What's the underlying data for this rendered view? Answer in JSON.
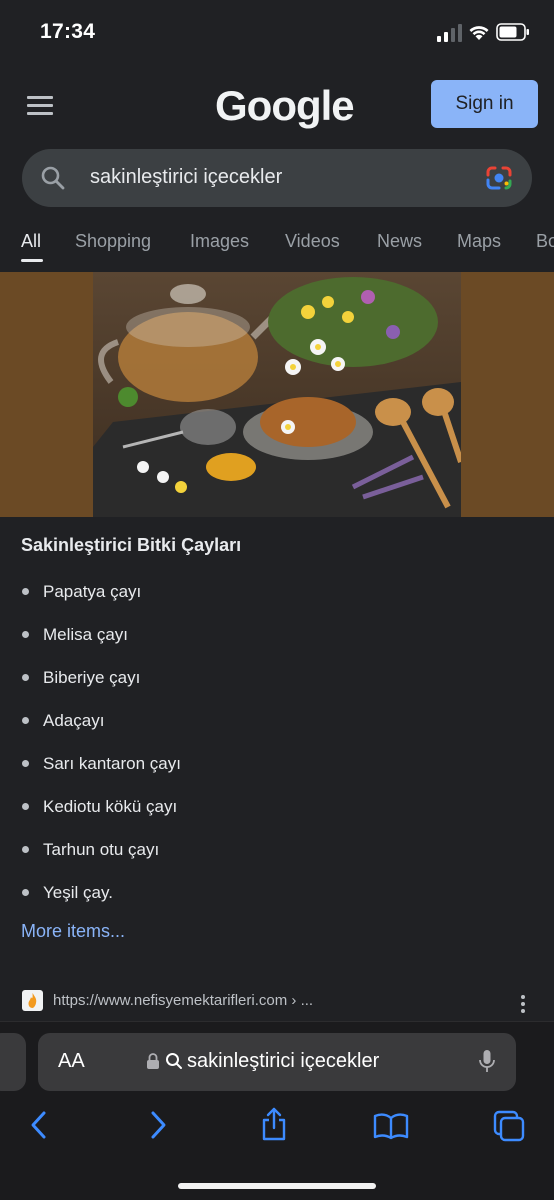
{
  "status_bar": {
    "time": "17:34"
  },
  "header": {
    "logo": "Google",
    "sign_in_label": "Sign in"
  },
  "search": {
    "query": "sakinleştirici içecekler"
  },
  "tabs": [
    "All",
    "Shopping",
    "Images",
    "Videos",
    "News",
    "Maps",
    "Bo"
  ],
  "active_tab": "All",
  "featured": {
    "title": "Sakinleştirici Bitki Çayları",
    "items": [
      "Papatya çayı",
      "Melisa çayı",
      "Biberiye çayı",
      "Adaçayı",
      "Sarı kantaron çayı",
      "Kediotu kökü çayı",
      "Tarhun otu çayı",
      "Yeşil çay."
    ],
    "more_label": "More items..."
  },
  "result": {
    "url": "https://www.nefisyemektarifleri.com › ..."
  },
  "safari": {
    "aa_label": "AA",
    "address_text": "sakinleştirici içecekler"
  },
  "icons": {
    "menu": "hamburger-icon",
    "search": "search-icon",
    "lens": "google-lens-icon",
    "lock": "lock-icon",
    "mic": "microphone-icon",
    "back": "chevron-left-icon",
    "forward": "chevron-right-icon",
    "share": "share-icon",
    "bookmarks": "book-icon",
    "tabs": "tabs-icon"
  },
  "colors": {
    "background": "#202124",
    "accent": "#8ab4f8",
    "search_bg": "#3c4043",
    "image_bg": "#6b4a25"
  }
}
